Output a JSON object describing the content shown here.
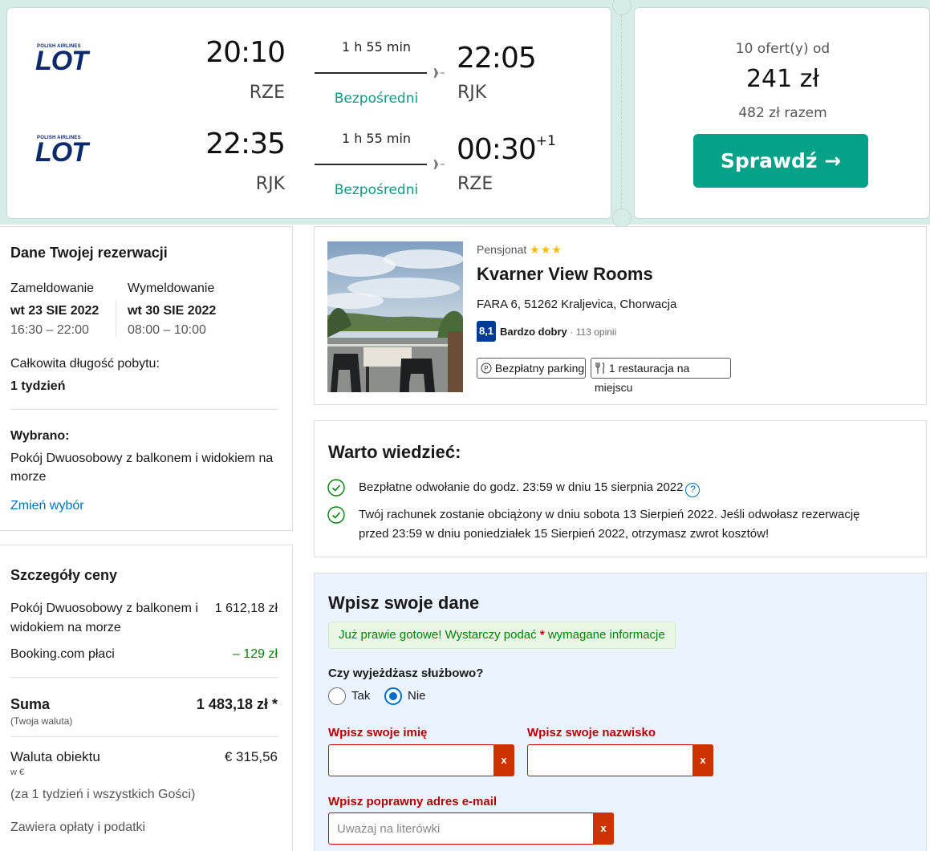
{
  "flight": {
    "legs": [
      {
        "airline_small": "POLISH AIRLINES",
        "airline": "LOT",
        "dep_time": "20:10",
        "arr_time": "22:05",
        "arr_suffix": "",
        "dep_code": "RZE",
        "arr_code": "RJK",
        "duration": "1 h 55 min",
        "stops": "Bezpośredni"
      },
      {
        "airline_small": "POLISH AIRLINES",
        "airline": "LOT",
        "dep_time": "22:35",
        "arr_time": "00:30",
        "arr_suffix": "+1",
        "dep_code": "RJK",
        "arr_code": "RZE",
        "duration": "1 h 55 min",
        "stops": "Bezpośredni"
      }
    ],
    "offers": "10 ofert(y) od",
    "price": "241 zł",
    "total": "482 zł razem",
    "check_button": "Sprawdź →"
  },
  "reservation": {
    "title": "Dane Twojej rezerwacji",
    "checkin_label": "Zameldowanie",
    "checkin_date": "wt 23 SIE 2022",
    "checkin_time": "16:30 – 22:00",
    "checkout_label": "Wymeldowanie",
    "checkout_date": "wt 30 SIE 2022",
    "checkout_time": "08:00 – 10:00",
    "length_label": "Całkowita długość pobytu:",
    "length_value": "1 tydzień",
    "selected_label": "Wybrano:",
    "selected_line1": "Pokój Dwuosobowy z balkonem i widokiem na",
    "selected_line2": "morze",
    "change_link": "Zmień wybór"
  },
  "price_details": {
    "title": "Szczegóły ceny",
    "room_line1": "Pokój Dwuosobowy z balkonem i",
    "room_line2": "widokiem na morze",
    "room_price": "1 612,18 zł",
    "booking_pays_label": "Booking.com płaci",
    "booking_pays_value": "– 129 zł",
    "sum_label": "Suma",
    "sum_sub": "(Twoja waluta)",
    "sum_value": "1 483,18 zł *",
    "property_currency_label": "Waluta obiektu",
    "property_currency_sub": "w €",
    "property_currency_value": "€ 315,56",
    "property_currency_note": "(za 1 tydzień i wszystkich Gości)",
    "fees_note": "Zawiera opłaty i podatki"
  },
  "hotel": {
    "type": "Pensjonat",
    "stars": "★★★",
    "name": "Kvarner View Rooms",
    "address": "FARA 6, 51262 Kraljevica, Chorwacja",
    "score": "8,1",
    "score_word": "Bardzo dobry",
    "reviews": "· 113 opinii",
    "facilities": [
      "Bezpłatny parking",
      "1 restauracja na miejscu"
    ],
    "facility_icons": [
      "parking-icon",
      "restaurant-icon"
    ]
  },
  "good_to_know": {
    "title": "Warto wiedzieć:",
    "item1": "Bezpłatne odwołanie do godz. 23:59 w dniu 15 sierpnia 2022",
    "item2_line1": "Twój rachunek zostanie obciążony w dniu sobota 13 Sierpień 2022. Jeśli odwołasz rezerwację",
    "item2_line2": "przed 23:59 w dniu poniedziałek 15 Sierpień 2022, otrzymasz zwrot kosztów!"
  },
  "form": {
    "title": "Wpisz swoje dane",
    "notice_before": "Już prawie gotowe! Wystarczy podać ",
    "notice_star": "*",
    "notice_after": " wymagane informacje",
    "business_question": "Czy wyjeżdżasz służbowo?",
    "option_yes": "Tak",
    "option_no": "Nie",
    "selected_option": "Nie",
    "first_name_label": "Wpisz swoje imię",
    "first_name_value": "",
    "last_name_label": "Wpisz swoje nazwisko",
    "last_name_value": "",
    "email_label": "Wpisz poprawny adres e-mail",
    "email_placeholder": "Uważaj na literówki",
    "error_glyph": "x"
  },
  "colors": {
    "accent_green": "#05a188",
    "booking_blue": "#0071c2",
    "score_navy": "#003b95",
    "error_red": "#cc0000",
    "lot_navy": "#0b2a6b"
  }
}
